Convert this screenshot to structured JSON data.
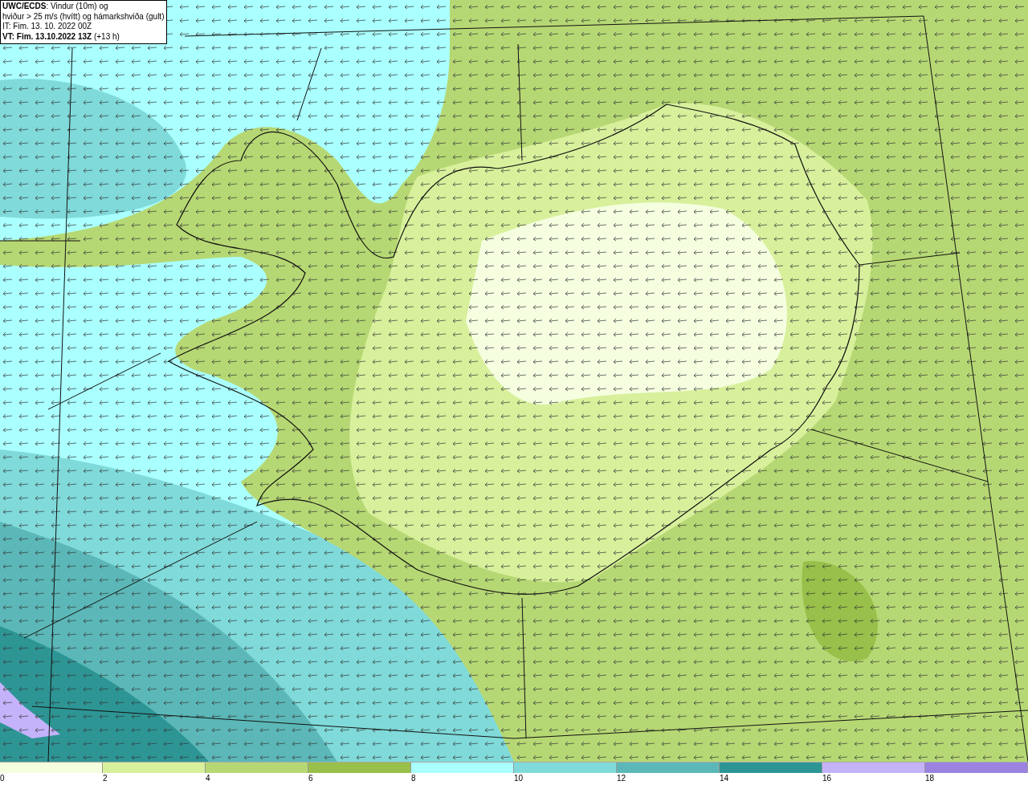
{
  "info_box": {
    "lines": [
      "**UWC/ECDS**: Vindur (10m) og",
      "hviður > 25 m/s (hvítt) og hámarkshviða (gult)",
      "IT: Fim. 13. 10. 2022 00Z",
      "**VT: Fim. 13.10.2022 13Z** (+13 h)"
    ]
  },
  "legend": [
    {
      "label": "0",
      "color": "#f5ffe0"
    },
    {
      "label": "2",
      "color": "#d8f09c"
    },
    {
      "label": "4",
      "color": "#b6d874"
    },
    {
      "label": "6",
      "color": "#98c04a"
    },
    {
      "label": "8",
      "color": "#aaffff"
    },
    {
      "label": "10",
      "color": "#80dada"
    },
    {
      "label": "12",
      "color": "#5cb8b8"
    },
    {
      "label": "14",
      "color": "#2e9595"
    },
    {
      "label": "16",
      "color": "#c4b3fb"
    },
    {
      "label": "18",
      "color": "#9b82e0"
    }
  ]
}
